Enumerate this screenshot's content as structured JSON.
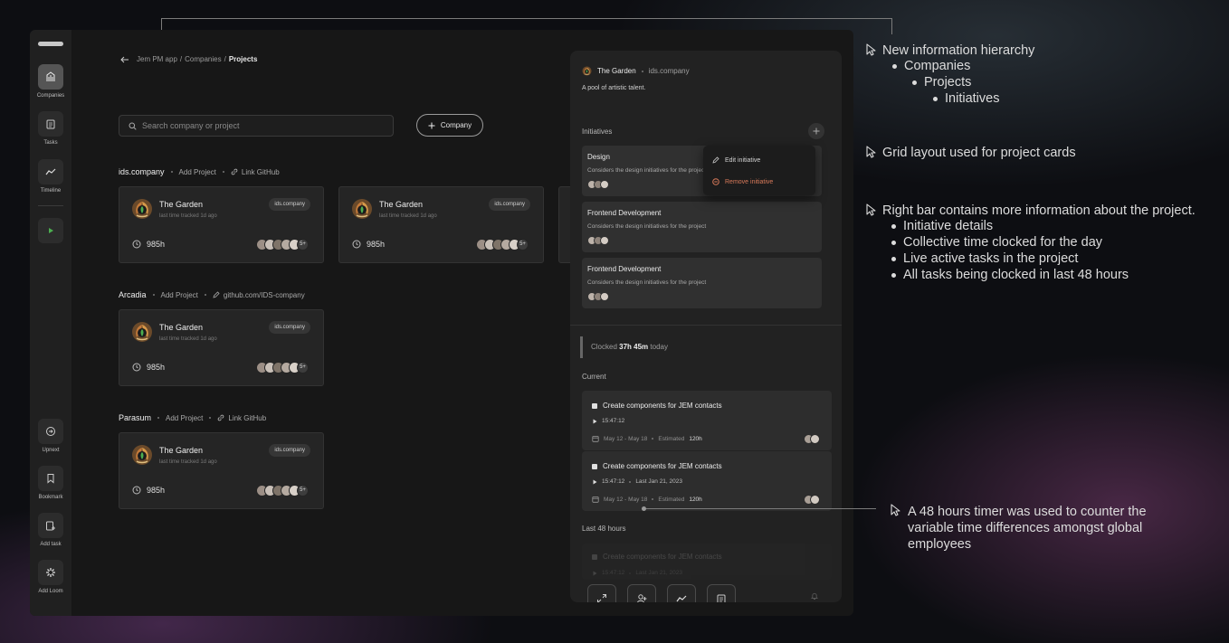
{
  "sidebar": {
    "items": [
      {
        "label": "Companies",
        "icon": "building-icon"
      },
      {
        "label": "Tasks",
        "icon": "clipboard-icon"
      },
      {
        "label": "Timeline",
        "icon": "chart-line-icon"
      },
      {
        "label": "",
        "icon": "play-icon"
      },
      {
        "label": "Upnext",
        "icon": "clock-arrow-icon"
      },
      {
        "label": "Bookmark",
        "icon": "bookmark-icon"
      },
      {
        "label": "Add task",
        "icon": "add-task-icon"
      },
      {
        "label": "Add Loom",
        "icon": "loom-icon"
      }
    ]
  },
  "breadcrumb": {
    "root": "Jem PM app",
    "sep1": "/",
    "mid": "Companies",
    "sep2": "/",
    "current": "Projects"
  },
  "search": {
    "placeholder": "Search company or project"
  },
  "add_company_label": "Company",
  "groups": [
    {
      "name": "ids.company",
      "add_project": "Add Project",
      "link": "Link GitHub",
      "cards": [
        {
          "title": "The Garden",
          "subtitle": "last time tracked 1d ago",
          "badge": "ids.company",
          "hours": "985h",
          "more": "5+"
        },
        {
          "title": "The Garden",
          "subtitle": "last time tracked 1d ago",
          "badge": "ids.company",
          "hours": "985h",
          "more": "5+"
        }
      ]
    },
    {
      "name": "Arcadia",
      "add_project": "Add Project",
      "link": "github.com/IDS-company",
      "cards": [
        {
          "title": "The Garden",
          "subtitle": "last time tracked 1d ago",
          "badge": "ids.company",
          "hours": "985h",
          "more": "5+"
        }
      ]
    },
    {
      "name": "Parasum",
      "add_project": "Add Project",
      "link": "Link GitHub",
      "cards": [
        {
          "title": "The Garden",
          "subtitle": "last time tracked 1d ago",
          "badge": "ids.company",
          "hours": "985h",
          "more": "5+"
        }
      ]
    }
  ],
  "panel": {
    "title": "The Garden",
    "company": "ids.company",
    "description": "A pool of artistic talent.",
    "initiatives_label": "Initiatives",
    "initiatives": [
      {
        "title": "Design",
        "desc": "Considers the design initiatives for the project"
      },
      {
        "title": "Frontend Development",
        "desc": "Considers the design initiatives for the project"
      },
      {
        "title": "Frontend Development",
        "desc": "Considers the design initiatives for the project"
      }
    ],
    "menu": {
      "edit": "Edit initiative",
      "remove": "Remove initiative"
    },
    "clocked": {
      "prefix": "Clocked",
      "value": "37h 45m",
      "suffix": "today"
    },
    "current_label": "Current",
    "tasks": [
      {
        "title": "Create components for JEM contacts",
        "time": "15:47:12",
        "last": "",
        "dates": "May 12 - May 18",
        "est_label": "Estimated",
        "est": "120h"
      },
      {
        "title": "Create components for JEM contacts",
        "time": "15:47:12",
        "last": "Last Jan 21, 2023",
        "dates": "May 12 - May 18",
        "est_label": "Estimated",
        "est": "120h"
      }
    ],
    "last48_label": "Last 48 hours",
    "faded_task": {
      "title": "Create components for JEM contacts",
      "time": "15:47:12",
      "last": "Last Jan 21, 2023"
    }
  },
  "annotations": {
    "a1": {
      "title": "New information hierarchy",
      "l1": "Companies",
      "l2": "Projects",
      "l3": "Initiatives"
    },
    "a2": {
      "title": "Grid layout used for project cards"
    },
    "a3": {
      "title": "Right bar contains more information about the project.",
      "items": [
        "Initiative details",
        "Collective time clocked for the day",
        "Live active tasks in the project",
        "All tasks being clocked in last 48 hours"
      ]
    },
    "a4": {
      "lines": [
        "A 48 hours timer was used to counter the",
        "variable time differences amongst global",
        "employees"
      ]
    }
  },
  "colors": {
    "accent_play": "#4caf50",
    "danger": "#d87a5a",
    "panel": "#222222",
    "card": "#252525"
  }
}
